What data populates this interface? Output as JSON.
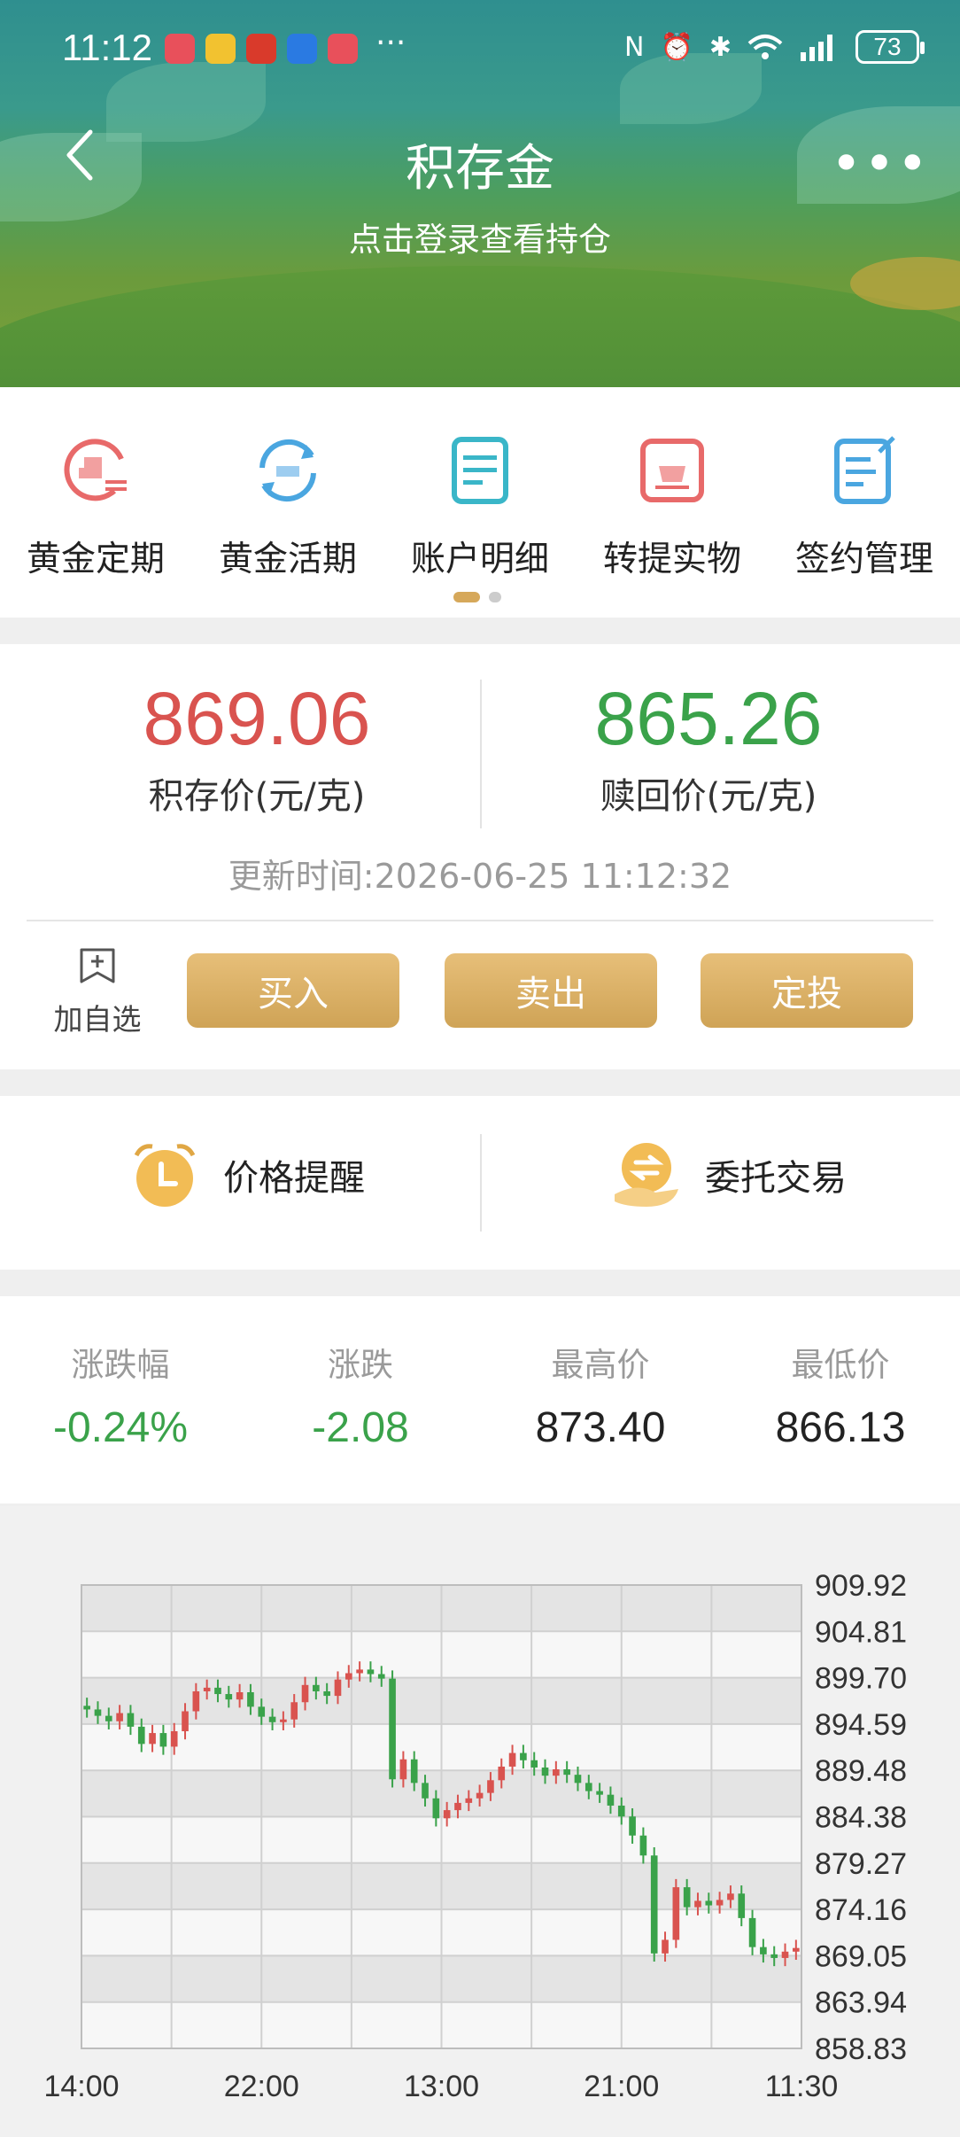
{
  "status": {
    "time": "11:12",
    "battery": "73"
  },
  "header": {
    "title": "积存金",
    "login_tip": "点击登录查看持仓"
  },
  "menu": {
    "items": [
      {
        "label": "黄金定期",
        "icon": "gold-fixed-icon"
      },
      {
        "label": "黄金活期",
        "icon": "gold-current-icon"
      },
      {
        "label": "账户明细",
        "icon": "account-detail-icon"
      },
      {
        "label": "转提实物",
        "icon": "physical-gold-icon"
      },
      {
        "label": "签约管理",
        "icon": "contract-manage-icon"
      }
    ]
  },
  "prices": {
    "deposit_price": "869.06",
    "deposit_label": "积存价(元/克)",
    "redeem_price": "865.26",
    "redeem_label": "赎回价(元/克)",
    "update_time": "更新时间:2026-06-25 11:12:32"
  },
  "actions": {
    "favorite": "加自选",
    "buy": "买入",
    "sell": "卖出",
    "fixed_invest": "定投"
  },
  "tools": {
    "price_alert": "价格提醒",
    "entrust": "委托交易"
  },
  "stats": [
    {
      "key": "涨跌幅",
      "value": "-0.24%"
    },
    {
      "key": "涨跌",
      "value": "-2.08"
    },
    {
      "key": "最高价",
      "value": "873.40"
    },
    {
      "key": "最低价",
      "value": "866.13"
    }
  ],
  "colors": {
    "up": "#d9534f",
    "down": "#3aa24a",
    "gold": "#d6a85a"
  },
  "chart_data": {
    "type": "candlestick",
    "y_ticks": [
      "909.92",
      "904.81",
      "899.70",
      "894.59",
      "889.48",
      "884.38",
      "879.27",
      "874.16",
      "869.05",
      "863.94",
      "858.83"
    ],
    "ylim": [
      858.83,
      909.92
    ],
    "x_ticks": [
      "14:00",
      "22:00",
      "13:00",
      "21:00",
      "11:30"
    ],
    "grid": true,
    "close_series": [
      896.2,
      895.5,
      894.9,
      895.8,
      894.3,
      892.4,
      893.6,
      892.1,
      893.8,
      896.0,
      898.2,
      898.6,
      897.9,
      897.3,
      898.1,
      896.5,
      895.4,
      894.8,
      895.1,
      897.0,
      898.9,
      898.2,
      897.7,
      899.5,
      900.2,
      900.6,
      900.1,
      899.6,
      888.5,
      890.7,
      888.1,
      886.4,
      884.2,
      885.1,
      885.9,
      886.4,
      887.0,
      888.4,
      889.9,
      891.4,
      890.6,
      889.8,
      888.9,
      889.6,
      889.0,
      888.1,
      887.2,
      886.8,
      885.6,
      884.4,
      882.3,
      880.1,
      869.3,
      870.8,
      876.6,
      874.4,
      875.1,
      874.6,
      875.2,
      875.9,
      873.2,
      870.0,
      869.2,
      868.8,
      869.5,
      869.9
    ]
  }
}
